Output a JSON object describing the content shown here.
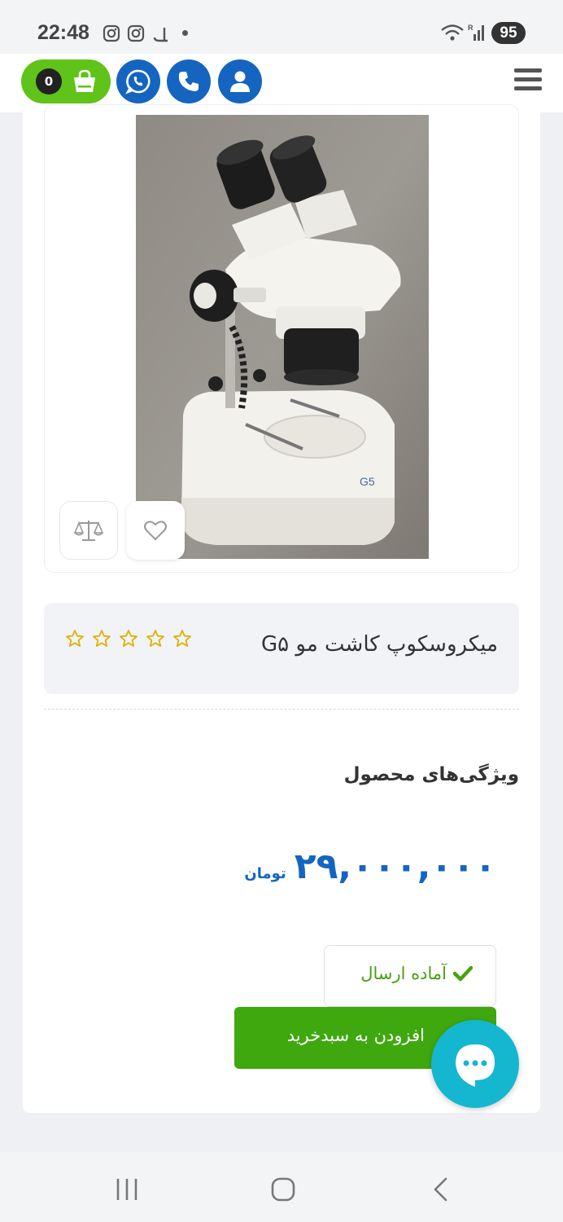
{
  "status_bar": {
    "time": "22:48",
    "notification_icons": [
      "instagram-icon",
      "instagram-icon",
      "app-icon"
    ],
    "battery": "95"
  },
  "header": {
    "cart_count": "0",
    "buttons": [
      "user-icon",
      "phone-icon",
      "whatsapp-icon",
      "shopping-bag-icon"
    ],
    "accent_color": "#1565c0",
    "cart_color": "#5fc319"
  },
  "product": {
    "title": "میکروسکوپ کاشت مو G۵",
    "rating_stars": 5,
    "rating_value": 0,
    "image_label": "G5",
    "features_title": "ویژگی‌های محصول",
    "price": "۲۹,۰۰۰,۰۰۰",
    "currency": "تومان",
    "availability": "آماده ارسال",
    "add_to_cart": "افزودن به سبدخرید"
  },
  "colors": {
    "success": "#46a113",
    "button_green": "#3fa80f",
    "chat": "#14b7cf",
    "star": "#e0b000"
  }
}
